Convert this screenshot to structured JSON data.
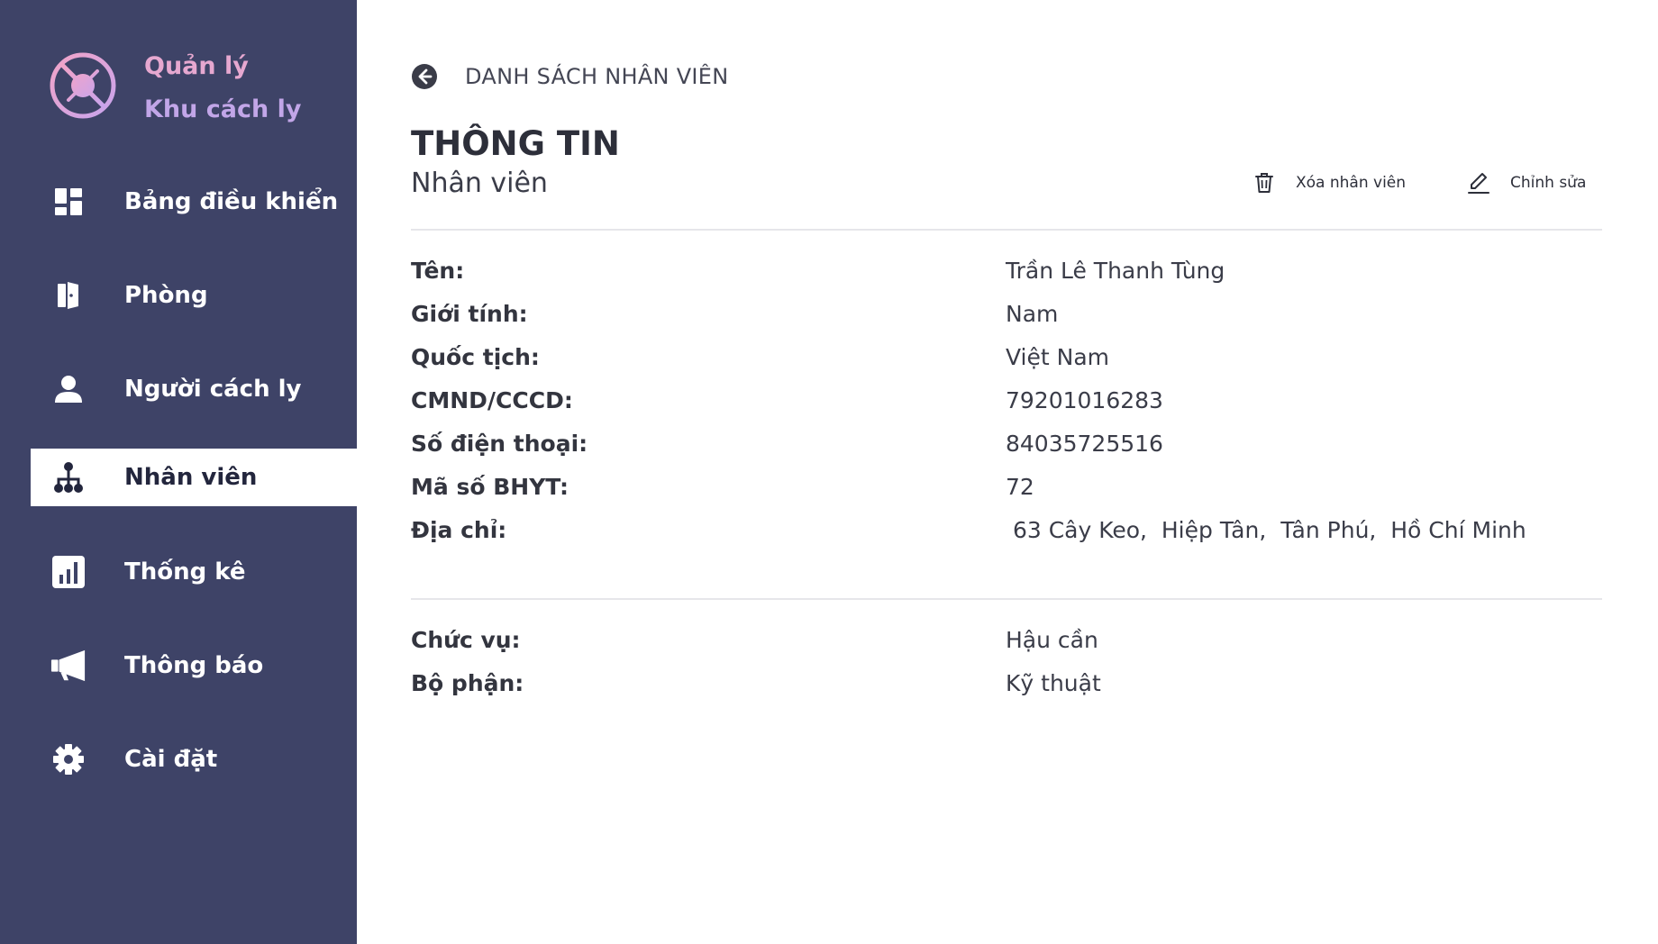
{
  "brand": {
    "line1": "Quản lý",
    "line2": "Khu cách ly",
    "logo_icon": "no-virus-icon"
  },
  "sidebar": {
    "items": [
      {
        "label": "Bảng điều khiển",
        "icon": "dashboard-icon",
        "active": false
      },
      {
        "label": "Phòng",
        "icon": "door-icon",
        "active": false
      },
      {
        "label": "Người cách ly",
        "icon": "person-icon",
        "active": false
      },
      {
        "label": "Nhân viên",
        "icon": "org-chart-icon",
        "active": true
      },
      {
        "label": "Thống kê",
        "icon": "bar-chart-icon",
        "active": false
      },
      {
        "label": "Thông báo",
        "icon": "megaphone-icon",
        "active": false
      },
      {
        "label": "Cài đặt",
        "icon": "gear-icon",
        "active": false
      }
    ]
  },
  "header": {
    "back_label": "DANH SÁCH NHÂN VIÊN",
    "title": "THÔNG TIN",
    "subtitle": "Nhân viên",
    "delete_label": "Xóa nhân viên",
    "edit_label": "Chỉnh sửa"
  },
  "personal": [
    {
      "label": "Tên:",
      "value": "Trần Lê Thanh Tùng"
    },
    {
      "label": "Giới tính:",
      "value": "Nam"
    },
    {
      "label": "Quốc tịch:",
      "value": "Việt Nam"
    },
    {
      "label": "CMND/CCCD:",
      "value": "79201016283"
    },
    {
      "label": "Số điện thoại:",
      "value": "84035725516"
    },
    {
      "label": "Mã số BHYT:",
      "value": "72"
    },
    {
      "label": "Địa chỉ:",
      "value": " 63 Cây Keo,  Hiệp Tân,  Tân Phú,  Hồ Chí Minh"
    }
  ],
  "job": [
    {
      "label": "Chức vụ:",
      "value": "Hậu cần"
    },
    {
      "label": "Bộ phận:",
      "value": "Kỹ thuật"
    }
  ],
  "colors": {
    "sidebar_bg": "#3e4367",
    "brand_pink": "#e6a8d0",
    "brand_purple": "#c2a6e8",
    "text_dark": "#2d2f3a"
  }
}
